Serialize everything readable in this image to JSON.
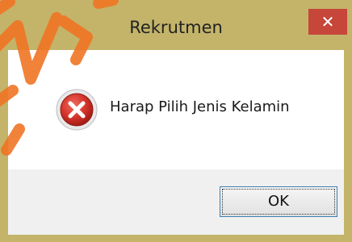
{
  "window": {
    "title": "Rekrutmen",
    "close_glyph": "✕",
    "frame_color": "#c3b46a",
    "close_color": "#c7463a"
  },
  "dialog": {
    "icon": "error-icon",
    "message": "Harap Pilih Jenis Kelamin",
    "ok_label": "OK"
  }
}
